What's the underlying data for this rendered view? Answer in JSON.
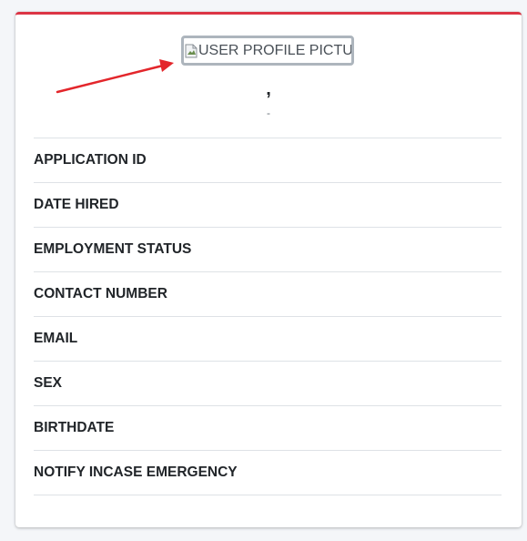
{
  "profile": {
    "picture_alt": "USER PROFILE PICTURE",
    "name": ",",
    "subtitle": "-"
  },
  "details": [
    {
      "label": "APPLICATION ID"
    },
    {
      "label": "DATE HIRED"
    },
    {
      "label": "EMPLOYMENT STATUS"
    },
    {
      "label": "CONTACT NUMBER"
    },
    {
      "label": "EMAIL"
    },
    {
      "label": "SEX"
    },
    {
      "label": "BIRTHDATE"
    },
    {
      "label": "NOTIFY INCASE EMERGENCY"
    }
  ],
  "colors": {
    "card_top_border": "#dc3545",
    "annotation_arrow": "#e3262b"
  },
  "icons": {
    "broken_image": "broken-image-icon",
    "annotation": "red-arrow-annotation"
  }
}
